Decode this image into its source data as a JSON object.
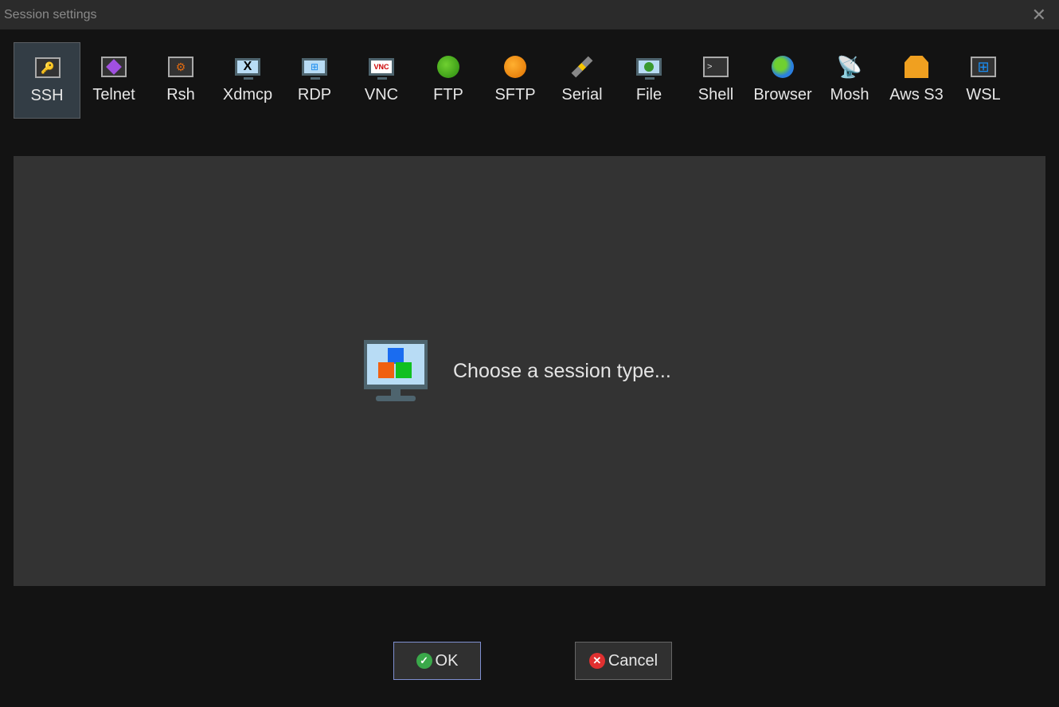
{
  "window": {
    "title": "Session settings"
  },
  "tabs": [
    {
      "label": "SSH",
      "icon": "key-icon",
      "selected": true
    },
    {
      "label": "Telnet",
      "icon": "gem-icon"
    },
    {
      "label": "Rsh",
      "icon": "gears-icon"
    },
    {
      "label": "Xdmcp",
      "icon": "x-monitor-icon"
    },
    {
      "label": "RDP",
      "icon": "windows-monitor-icon"
    },
    {
      "label": "VNC",
      "icon": "vnc-monitor-icon"
    },
    {
      "label": "FTP",
      "icon": "green-globe-icon"
    },
    {
      "label": "SFTP",
      "icon": "orange-globe-icon"
    },
    {
      "label": "Serial",
      "icon": "plug-icon"
    },
    {
      "label": "File",
      "icon": "globe-monitor-icon"
    },
    {
      "label": "Shell",
      "icon": "terminal-icon"
    },
    {
      "label": "Browser",
      "icon": "earth-icon"
    },
    {
      "label": "Mosh",
      "icon": "satellite-icon"
    },
    {
      "label": "Aws S3",
      "icon": "cubes-icon"
    },
    {
      "label": "WSL",
      "icon": "windows-box-icon"
    }
  ],
  "main": {
    "message": "Choose a session type..."
  },
  "buttons": {
    "ok": "OK",
    "cancel": "Cancel"
  },
  "colors": {
    "background": "#131313",
    "panel": "#333333",
    "selected_tab": "#333d45"
  }
}
